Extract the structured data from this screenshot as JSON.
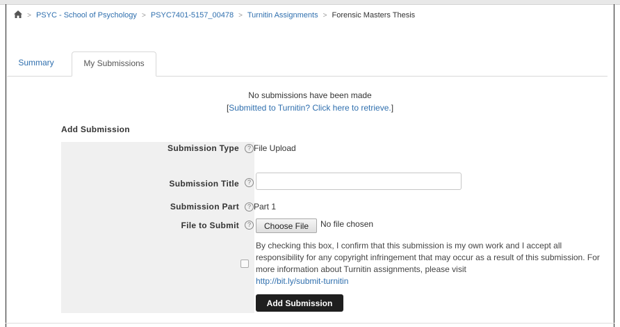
{
  "breadcrumb": {
    "items": [
      "PSYC - School of Psychology",
      "PSYC7401-5157_00478",
      "Turnitin Assignments"
    ],
    "current": "Forensic Masters Thesis"
  },
  "tabs": [
    {
      "label": "Summary",
      "active": false
    },
    {
      "label": "My Submissions",
      "active": true
    }
  ],
  "status": {
    "no_submissions": "No submissions have been made",
    "retrieve_open": "[",
    "retrieve_link": "Submitted to Turnitin? Click here to retrieve.",
    "retrieve_close": "]"
  },
  "form": {
    "section_title": "Add Submission",
    "fields": {
      "type_label": "Submission Type",
      "type_value": "File Upload",
      "title_label": "Submission Title",
      "title_value": "",
      "part_label": "Submission Part",
      "part_value": "Part 1",
      "file_label": "File to Submit",
      "file_button": "Choose File",
      "file_status": "No file chosen"
    },
    "help_symbol": "?",
    "confirm_text": "By checking this box, I confirm that this submission is my own work and I accept all responsibility for any copyright infringement that may occur as a result of this submission. For more information about Turnitin assignments, please visit",
    "confirm_link": "http://bit.ly/submit-turnitin",
    "confirm_checked": false,
    "submit_label": "Add Submission"
  },
  "colors": {
    "link": "#2f6fae",
    "panel_bg": "#f0f0f0",
    "submit_bg": "#1f1f1f"
  }
}
